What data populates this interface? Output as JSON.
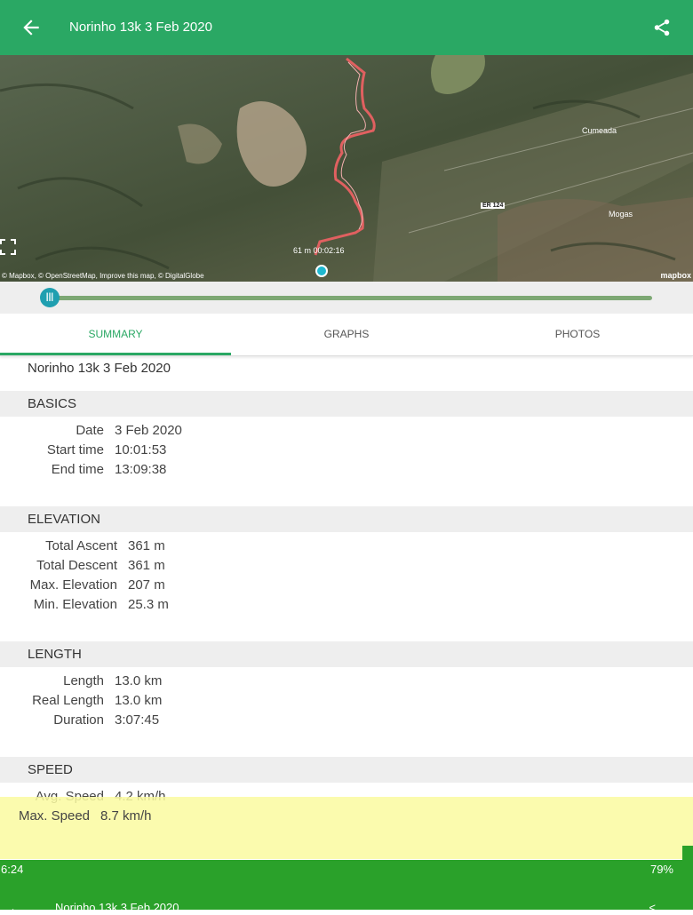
{
  "header": {
    "title": "Norinho 13k 3 Feb 2020"
  },
  "map": {
    "attribution": "© Mapbox, © OpenStreetMap, Improve this map, © DigitalGlobe",
    "mapbox_logo": "mapbox",
    "places": [
      "Cumeada",
      "Mogas"
    ],
    "road_label": "ER 124",
    "marker_label": "61 m  00:02:16",
    "route_color": "#e06060"
  },
  "slider": {
    "position": 0.0
  },
  "tabs": [
    {
      "label": "SUMMARY",
      "active": true
    },
    {
      "label": "GRAPHS",
      "active": false
    },
    {
      "label": "PHOTOS",
      "active": false
    }
  ],
  "summary": {
    "track_name": "Norinho 13k 3 Feb 2020",
    "basics": {
      "heading": "BASICS",
      "rows": [
        {
          "label": "Date",
          "value": "3 Feb 2020"
        },
        {
          "label": "Start time",
          "value": "10:01:53"
        },
        {
          "label": "End time",
          "value": "13:09:38"
        }
      ]
    },
    "elevation": {
      "heading": "ELEVATION",
      "rows": [
        {
          "label": "Total Ascent",
          "value": "361 m"
        },
        {
          "label": "Total Descent",
          "value": "361 m"
        },
        {
          "label": "Max. Elevation",
          "value": "207 m"
        },
        {
          "label": "Min. Elevation",
          "value": "25.3 m"
        }
      ]
    },
    "length": {
      "heading": "LENGTH",
      "rows": [
        {
          "label": "Length",
          "value": "13.0 km"
        },
        {
          "label": "Real Length",
          "value": "13.0 km"
        },
        {
          "label": "Duration",
          "value": "3:07:45"
        }
      ]
    },
    "speed": {
      "heading": "SPEED",
      "rows": [
        {
          "label": "Avg. Speed",
          "value": "4.2 km/h"
        },
        {
          "label": "Max. Speed",
          "value": "8.7 km/h"
        }
      ]
    }
  },
  "statusbar": {
    "time": "6:24",
    "battery": "79%"
  },
  "colors": {
    "primary": "#2aa864",
    "accent": "#1f9fb0",
    "statusbar": "#2aa12a"
  },
  "icons": [
    "back-arrow-icon",
    "share-icon",
    "fullscreen-icon",
    "location-dot-icon",
    "slider-thumb-icon"
  ]
}
